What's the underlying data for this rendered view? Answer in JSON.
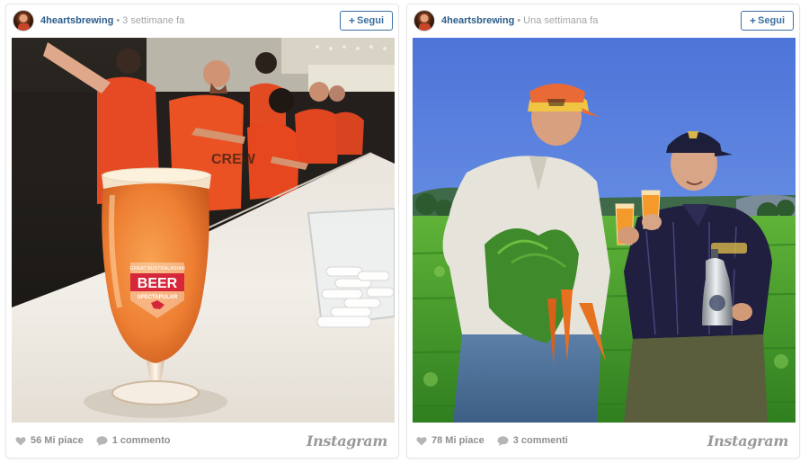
{
  "posts": [
    {
      "username": "4heartsbrewing",
      "separator": "•",
      "time": "3 settimane fa",
      "follow_label": "Segui",
      "likes": "56 Mi piace",
      "comments": "1 commento",
      "brand": "Instagram",
      "glass_label": {
        "top": "GREAT AUSTRALASIAN",
        "main": "BEER",
        "bottom": "SPECTAPULAR"
      },
      "shirt_text": "CREW"
    },
    {
      "username": "4heartsbrewing",
      "separator": "•",
      "time": "Una settimana fa",
      "follow_label": "Segui",
      "likes": "78 Mi piace",
      "comments": "3 commenti",
      "brand": "Instagram"
    }
  ],
  "icons": {
    "heart": "heart-icon",
    "comment": "comment-bubble-icon",
    "plus": "plus-icon"
  },
  "colors": {
    "username": "#2a5d8a",
    "follow_border": "#3a6fa2",
    "muted": "#a5a5a5",
    "footer_text": "#8f8f8f"
  }
}
